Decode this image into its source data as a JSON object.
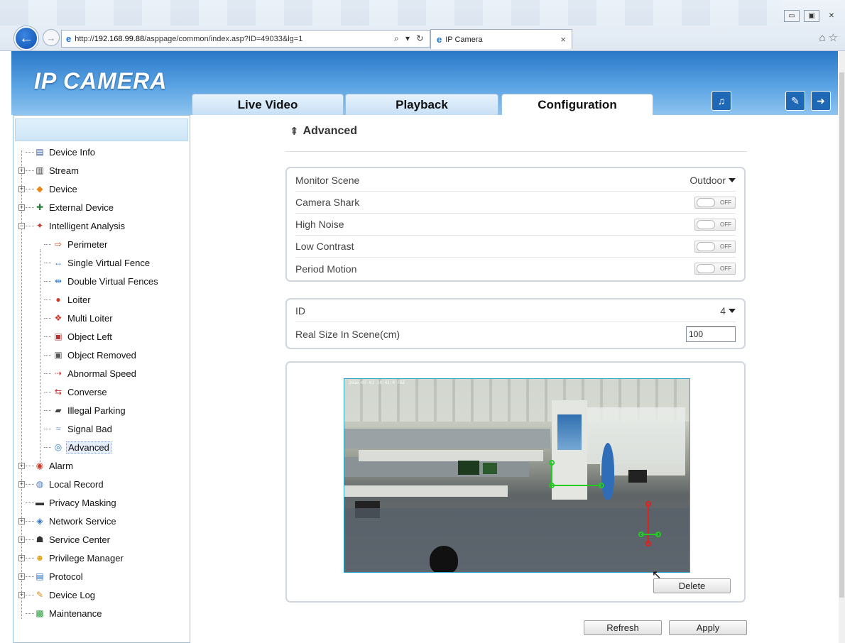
{
  "browser": {
    "url_prefix": "http://",
    "url_host": "192.168.99.88",
    "url_path": "/asppage/common/index.asp?ID=49033&lg=1",
    "address_controls": "⌕ ▾ ↻",
    "tab_title": "IP Camera",
    "tab_close": "×"
  },
  "app": {
    "logo": "IP CAMERA",
    "tabs": {
      "live": "Live Video",
      "playback": "Playback",
      "config": "Configuration"
    }
  },
  "sidebar": {
    "items": [
      {
        "label": "Device Info",
        "icon": "document-icon",
        "glyph": "▤",
        "color": "#3a5f9a"
      },
      {
        "label": "Stream",
        "icon": "stream-icon",
        "glyph": "▥",
        "color": "#333"
      },
      {
        "label": "Device",
        "icon": "device-icon",
        "glyph": "◆",
        "color": "#e58a1a"
      },
      {
        "label": "External Device",
        "icon": "external-device-icon",
        "glyph": "✚",
        "color": "#2a7a3a"
      },
      {
        "label": "Intelligent Analysis",
        "icon": "intelligent-analysis-icon",
        "glyph": "✦",
        "color": "#c43c2a"
      },
      {
        "label": "Perimeter",
        "icon": "perimeter-icon",
        "glyph": "⇨",
        "color": "#d24a1e"
      },
      {
        "label": "Single Virtual Fence",
        "icon": "single-fence-icon",
        "glyph": "↔",
        "color": "#2c7bd0"
      },
      {
        "label": "Double Virtual Fences",
        "icon": "double-fence-icon",
        "glyph": "⇹",
        "color": "#2c7bd0"
      },
      {
        "label": "Loiter",
        "icon": "loiter-icon",
        "glyph": "●",
        "color": "#d23a2a"
      },
      {
        "label": "Multi Loiter",
        "icon": "multi-loiter-icon",
        "glyph": "❖",
        "color": "#d23a2a"
      },
      {
        "label": "Object Left",
        "icon": "object-left-icon",
        "glyph": "▣",
        "color": "#b33"
      },
      {
        "label": "Object Removed",
        "icon": "object-removed-icon",
        "glyph": "▣",
        "color": "#555"
      },
      {
        "label": "Abnormal Speed",
        "icon": "abnormal-speed-icon",
        "glyph": "⇢",
        "color": "#c33"
      },
      {
        "label": "Converse",
        "icon": "converse-icon",
        "glyph": "⇆",
        "color": "#c33"
      },
      {
        "label": "Illegal Parking",
        "icon": "illegal-parking-icon",
        "glyph": "▰",
        "color": "#444"
      },
      {
        "label": "Signal Bad",
        "icon": "signal-bad-icon",
        "glyph": "≈",
        "color": "#6aa0d8"
      },
      {
        "label": "Advanced",
        "icon": "advanced-icon",
        "glyph": "◎",
        "color": "#2c7bd0"
      },
      {
        "label": "Alarm",
        "icon": "alarm-icon",
        "glyph": "◉",
        "color": "#d23a2a"
      },
      {
        "label": "Local Record",
        "icon": "local-record-icon",
        "glyph": "◍",
        "color": "#4a7ab8"
      },
      {
        "label": "Privacy Masking",
        "icon": "privacy-masking-icon",
        "glyph": "▬",
        "color": "#333"
      },
      {
        "label": "Network Service",
        "icon": "network-service-icon",
        "glyph": "◈",
        "color": "#2c6fc0"
      },
      {
        "label": "Service Center",
        "icon": "service-center-icon",
        "glyph": "☗",
        "color": "#333"
      },
      {
        "label": "Privilege Manager",
        "icon": "privilege-manager-icon",
        "glyph": "☻",
        "color": "#e0a21a"
      },
      {
        "label": "Protocol",
        "icon": "protocol-icon",
        "glyph": "▤",
        "color": "#2c6fc0"
      },
      {
        "label": "Device Log",
        "icon": "device-log-icon",
        "glyph": "✎",
        "color": "#d28a1e"
      },
      {
        "label": "Maintenance",
        "icon": "maintenance-icon",
        "glyph": "▩",
        "color": "#2a9a3a"
      }
    ]
  },
  "page": {
    "title": "Advanced",
    "scene": {
      "monitor_scene_label": "Monitor Scene",
      "monitor_scene_value": "Outdoor",
      "toggles": [
        {
          "label": "Camera Shark",
          "state": "OFF"
        },
        {
          "label": "High Noise",
          "state": "OFF"
        },
        {
          "label": "Low Contrast",
          "state": "OFF"
        },
        {
          "label": "Period Motion",
          "state": "OFF"
        }
      ]
    },
    "size": {
      "id_label": "ID",
      "id_value": "4",
      "real_size_label": "Real Size In Scene(cm)",
      "real_size_value": "100"
    },
    "buttons": {
      "delete": "Delete",
      "refresh": "Refresh",
      "apply": "Apply"
    }
  },
  "colors": {
    "header_blue": "#2a78c8",
    "ruler_green": "#22cc22",
    "ruler_red": "#dd2222"
  }
}
